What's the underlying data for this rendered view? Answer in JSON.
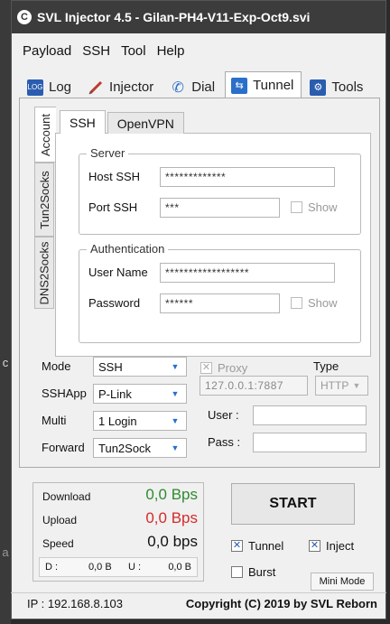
{
  "background": {
    "left_mark": "c",
    "left_mark2": "a"
  },
  "window": {
    "title": "SVL Injector 4.5 - Gilan-PH4-V11-Exp-Oct9.svi",
    "icon": "C"
  },
  "menu": [
    "Payload",
    "SSH",
    "Tool",
    "Help"
  ],
  "tabs": [
    {
      "label": "Log",
      "icon": "log-icon"
    },
    {
      "label": "Injector",
      "icon": "syringe-icon"
    },
    {
      "label": "Dial",
      "icon": "phone-icon"
    },
    {
      "label": "Tunnel",
      "icon": "tunnel-icon",
      "active": true
    },
    {
      "label": "Tools",
      "icon": "gear-icon"
    }
  ],
  "vertical_tabs": [
    "Account",
    "Tun2Socks",
    "DNS2Socks"
  ],
  "sub_tabs": [
    "SSH",
    "OpenVPN"
  ],
  "server": {
    "legend": "Server",
    "host_label": "Host SSH",
    "host_value": "*************",
    "port_label": "Port SSH",
    "port_value": "***",
    "show_label": "Show"
  },
  "auth": {
    "legend": "Authentication",
    "user_label": "User Name",
    "user_value": "******************",
    "pass_label": "Password",
    "pass_value": "******",
    "show_label": "Show"
  },
  "settings": {
    "mode_label": "Mode",
    "mode_value": "SSH",
    "sshapp_label": "SSHApp",
    "sshapp_value": "P-Link",
    "multi_label": "Multi",
    "multi_value": "1 Login",
    "forward_label": "Forward",
    "forward_value": "Tun2Sock",
    "proxy_label": "Proxy",
    "proxy_value": "127.0.0.1:7887",
    "type_label": "Type",
    "type_value": "HTTP",
    "user_label": "User :",
    "pass_label": "Pass :",
    "user_value": "",
    "pass_value": ""
  },
  "stats": {
    "download_label": "Download",
    "download_value": "0,0 Bps",
    "upload_label": "Upload",
    "upload_value": "0,0 Bps",
    "speed_label": "Speed",
    "speed_value": "0,0 bps",
    "d_label": "D :",
    "d_value": "0,0 B",
    "u_label": "U :",
    "u_value": "0,0 B"
  },
  "controls": {
    "start_label": "START",
    "tunnel_label": "Tunnel",
    "inject_label": "Inject",
    "burst_label": "Burst",
    "minimode_label": "Mini Mode"
  },
  "status": {
    "ip": "IP : 192.168.8.103",
    "copyright": "Copyright (C) 2019 by SVL Reborn"
  },
  "colors": {
    "titlebar": "#3c3c3c",
    "download": "#2e8b2e",
    "upload": "#d42a2a",
    "accent": "#2a6fc9"
  }
}
